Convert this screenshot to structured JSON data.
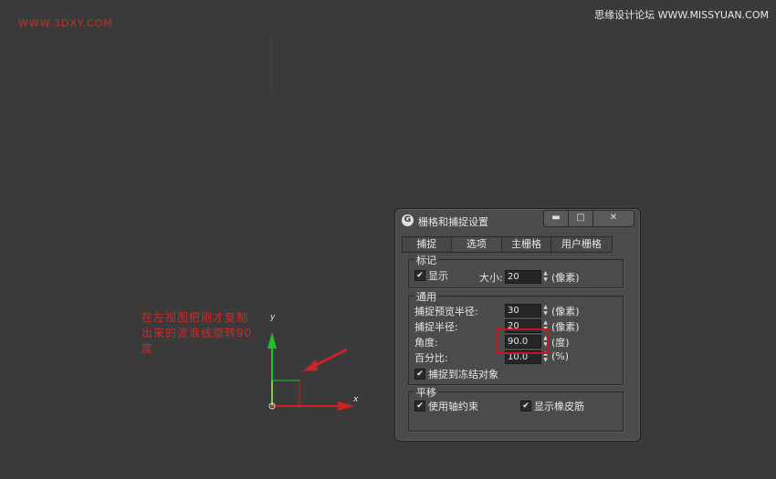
{
  "watermarks": {
    "left": "WWW.3DXY.COM",
    "right": "思缘设计论坛 WWW.MISSYUAN.COM"
  },
  "note": {
    "text": "在左视图把刚才复制出来的波浪线旋转90度"
  },
  "scene": {
    "axis_y": "y",
    "axis_x": "x"
  },
  "dialog": {
    "icon": "G",
    "title": "栅格和捕捉设置",
    "tabs": [
      {
        "label": "捕捉"
      },
      {
        "label": "选项"
      },
      {
        "label": "主栅格"
      },
      {
        "label": "用户栅格"
      }
    ],
    "marks": {
      "title": "标记",
      "show_label": "显示",
      "size_label": "大小:",
      "size_value": "20",
      "size_unit": "(像素)"
    },
    "general": {
      "title": "通用",
      "preview_radius_label": "捕捉预览半径:",
      "preview_radius_value": "30",
      "preview_radius_unit": "(像素)",
      "snap_radius_label": "捕捉半径:",
      "snap_radius_value": "20",
      "snap_radius_unit": "(像素)",
      "angle_label": "角度:",
      "angle_value": "90.0",
      "angle_unit": "(度)",
      "percent_label": "百分比:",
      "percent_value": "10.0",
      "percent_unit": "(%)",
      "snap_frozen_label": "捕捉到冻结对象"
    },
    "translate": {
      "title": "平移",
      "axis_constraint_label": "使用轴约束",
      "rubber_band_label": "显示橡皮筋"
    }
  }
}
